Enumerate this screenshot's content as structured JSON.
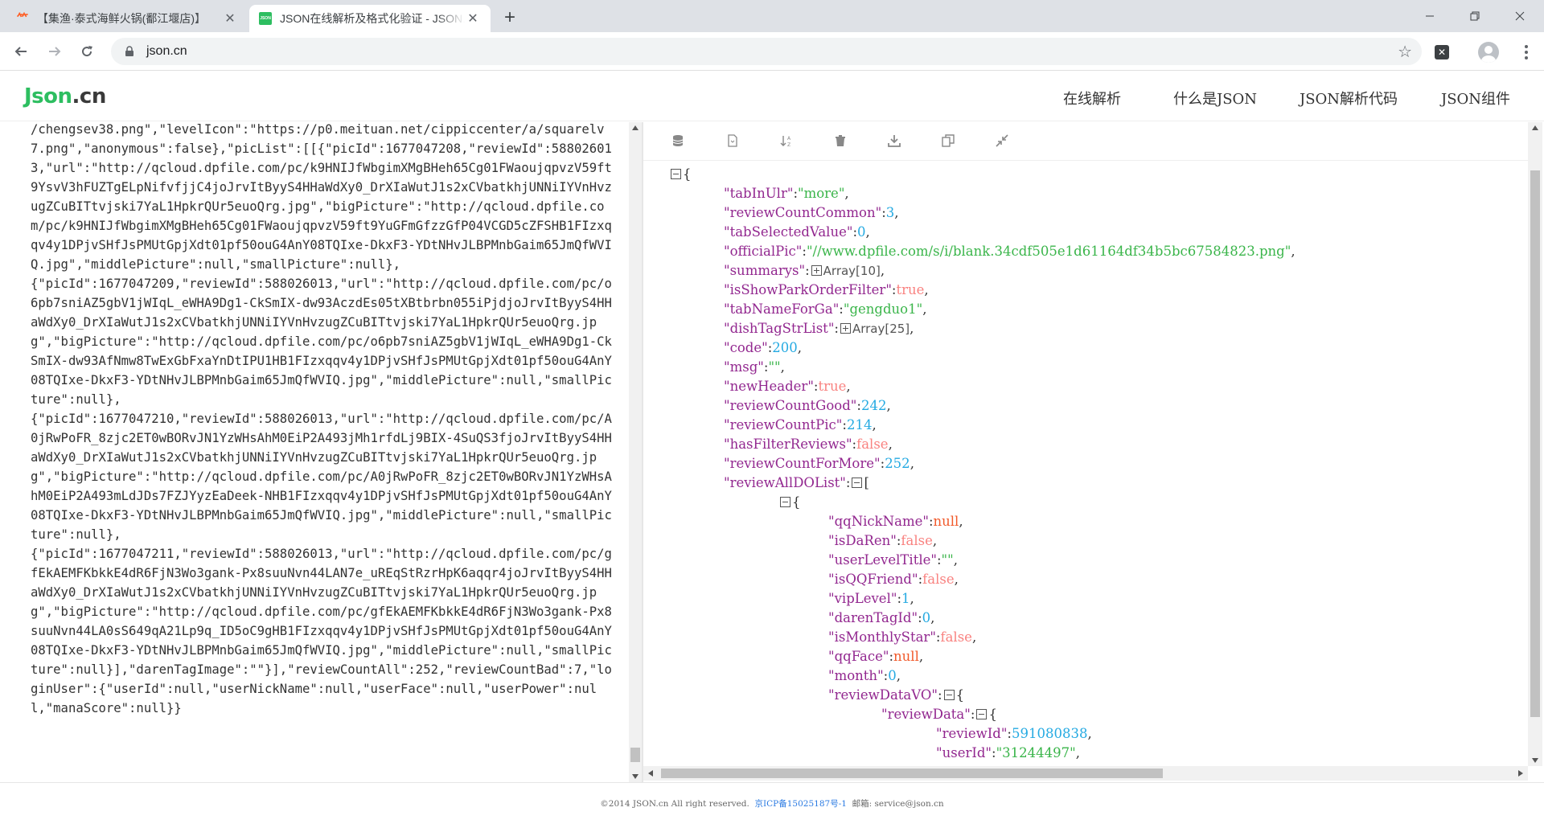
{
  "browser": {
    "tabs": [
      {
        "title": "【集渔·泰式海鲜火锅(鄱江堰店)】",
        "favicon": "meituan-icon"
      },
      {
        "title": "JSON在线解析及格式化验证 - JSON.cn",
        "favicon": "json-icon"
      }
    ],
    "url": "json.cn"
  },
  "site": {
    "logo_json": "Json",
    "logo_cn": ".cn",
    "nav": [
      "在线解析",
      "什么是JSON",
      "JSON解析代码",
      "JSON组件"
    ]
  },
  "raw_text": "/chengsev38.png\",\"levelIcon\":\"https://p0.meituan.net/cippiccenter/a/squarelv7.png\",\"anonymous\":false},\"picList\":[[{\"picId\":1677047208,\"reviewId\":588026013,\"url\":\"http://qcloud.dpfile.com/pc/k9HNIJfWbgimXMgBHeh65Cg01FWaoujqpvzV59ft9YsvV3hFUZTgELpNifvfjjC4joJrvItByyS4HHaWdXy0_DrXIaWutJ1s2xCVbatkhjUNNiIYVnHvzugZCuBITtvjski7YaL1HpkrQUr5euoQrg.jpg\",\"bigPicture\":\"http://qcloud.dpfile.com/pc/k9HNIJfWbgimXMgBHeh65Cg01FWaoujqpvzV59ft9YuGFmGfzzGfP04VCGD5cZFSHB1FIzxqqv4y1DPjvSHfJsPMUtGpjXdt01pf50ouG4AnY08TQIxe-DkxF3-YDtNHvJLBPMnbGaim65JmQfWVIQ.jpg\",\"middlePicture\":null,\"smallPicture\":null},\n{\"picId\":1677047209,\"reviewId\":588026013,\"url\":\"http://qcloud.dpfile.com/pc/o6pb7sniAZ5gbV1jWIqL_eWHA9Dg1-CkSmIX-dw93AczdEs05tXBtbrbn055iPjdjoJrvItByyS4HHaWdXy0_DrXIaWutJ1s2xCVbatkhjUNNiIYVnHvzugZCuBITtvjski7YaL1HpkrQUr5euoQrg.jpg\",\"bigPicture\":\"http://qcloud.dpfile.com/pc/o6pb7sniAZ5gbV1jWIqL_eWHA9Dg1-CkSmIX-dw93AfNmw8TwExGbFxaYnDtIPU1HB1FIzxqqv4y1DPjvSHfJsPMUtGpjXdt01pf50ouG4AnY08TQIxe-DkxF3-YDtNHvJLBPMnbGaim65JmQfWVIQ.jpg\",\"middlePicture\":null,\"smallPicture\":null},\n{\"picId\":1677047210,\"reviewId\":588026013,\"url\":\"http://qcloud.dpfile.com/pc/A0jRwPoFR_8zjc2ET0wBORvJN1YzWHsAhM0EiP2A493jMh1rfdLj9BIX-4SuQS3fjoJrvItByyS4HHaWdXy0_DrXIaWutJ1s2xCVbatkhjUNNiIYVnHvzugZCuBITtvjski7YaL1HpkrQUr5euoQrg.jpg\",\"bigPicture\":\"http://qcloud.dpfile.com/pc/A0jRwPoFR_8zjc2ET0wBORvJN1YzWHsAhM0EiP2A493mLdJDs7FZJYyzEaDeek-NHB1FIzxqqv4y1DPjvSHfJsPMUtGpjXdt01pf50ouG4AnY08TQIxe-DkxF3-YDtNHvJLBPMnbGaim65JmQfWVIQ.jpg\",\"middlePicture\":null,\"smallPicture\":null},\n{\"picId\":1677047211,\"reviewId\":588026013,\"url\":\"http://qcloud.dpfile.com/pc/gfEkAEMFKbkkE4dR6FjN3Wo3gank-Px8suuNvn44LAN7e_uREqStRzrHpK6aqqr4joJrvItByyS4HHaWdXy0_DrXIaWutJ1s2xCVbatkhjUNNiIYVnHvzugZCuBITtvjski7YaL1HpkrQUr5euoQrg.jpg\",\"bigPicture\":\"http://qcloud.dpfile.com/pc/gfEkAEMFKbkkE4dR6FjN3Wo3gank-Px8suuNvn44LA0sS649qA21Lp9q_ID5oC9gHB1FIzxqqv4y1DPjvSHfJsPMUtGpjXdt01pf50ouG4AnY08TQIxe-DkxF3-YDtNHvJLBPMnbGaim65JmQfWVIQ.jpg\",\"middlePicture\":null,\"smallPicture\":null}],\"darenTagImage\":\"\"}],\"reviewCountAll\":252,\"reviewCountBad\":7,\"loginUser\":{\"userId\":null,\"userNickName\":null,\"userFace\":null,\"userPower\":null,\"manaScore\":null}}",
  "tree": {
    "root_open": "{",
    "entries": [
      {
        "key": "tabInUlr",
        "type": "str",
        "value": "more"
      },
      {
        "key": "reviewCountCommon",
        "type": "num",
        "value": "3"
      },
      {
        "key": "tabSelectedValue",
        "type": "num",
        "value": "0"
      },
      {
        "key": "officialPic",
        "type": "str",
        "value": "//www.dpfile.com/s/i/blank.34cdf505e1d61164df34b5bc67584823.png"
      },
      {
        "key": "summarys",
        "type": "arr",
        "value": "Array[10]"
      },
      {
        "key": "isShowParkOrderFilter",
        "type": "bool",
        "value": "true"
      },
      {
        "key": "tabNameForGa",
        "type": "str",
        "value": "gengduo1"
      },
      {
        "key": "dishTagStrList",
        "type": "arr",
        "value": "Array[25]"
      },
      {
        "key": "code",
        "type": "num",
        "value": "200"
      },
      {
        "key": "msg",
        "type": "str",
        "value": ""
      },
      {
        "key": "newHeader",
        "type": "bool",
        "value": "true"
      },
      {
        "key": "reviewCountGood",
        "type": "num",
        "value": "242"
      },
      {
        "key": "reviewCountPic",
        "type": "num",
        "value": "214"
      },
      {
        "key": "hasFilterReviews",
        "type": "bool",
        "value": "false"
      },
      {
        "key": "reviewCountForMore",
        "type": "num",
        "value": "252"
      }
    ],
    "reviewAllDOList_key": "reviewAllDOList",
    "review_entries": [
      {
        "key": "qqNickName",
        "type": "null",
        "value": "null"
      },
      {
        "key": "isDaRen",
        "type": "bool",
        "value": "false"
      },
      {
        "key": "userLevelTitle",
        "type": "str",
        "value": ""
      },
      {
        "key": "isQQFriend",
        "type": "bool",
        "value": "false"
      },
      {
        "key": "vipLevel",
        "type": "num",
        "value": "1"
      },
      {
        "key": "darenTagId",
        "type": "num",
        "value": "0"
      },
      {
        "key": "isMonthlyStar",
        "type": "bool",
        "value": "false"
      },
      {
        "key": "qqFace",
        "type": "null",
        "value": "null"
      },
      {
        "key": "month",
        "type": "num",
        "value": "0"
      }
    ],
    "reviewDataVO_key": "reviewDataVO",
    "reviewData_key": "reviewData",
    "review_data_entries": [
      {
        "key": "reviewId",
        "type": "num",
        "value": "591080838"
      },
      {
        "key": "userId",
        "type": "str",
        "value": "31244497"
      }
    ]
  },
  "footer": {
    "copyright": "©2014 JSON.cn All right reserved.",
    "icp": "京ICP备15025187号-1",
    "email": "邮箱: service@json.cn"
  }
}
